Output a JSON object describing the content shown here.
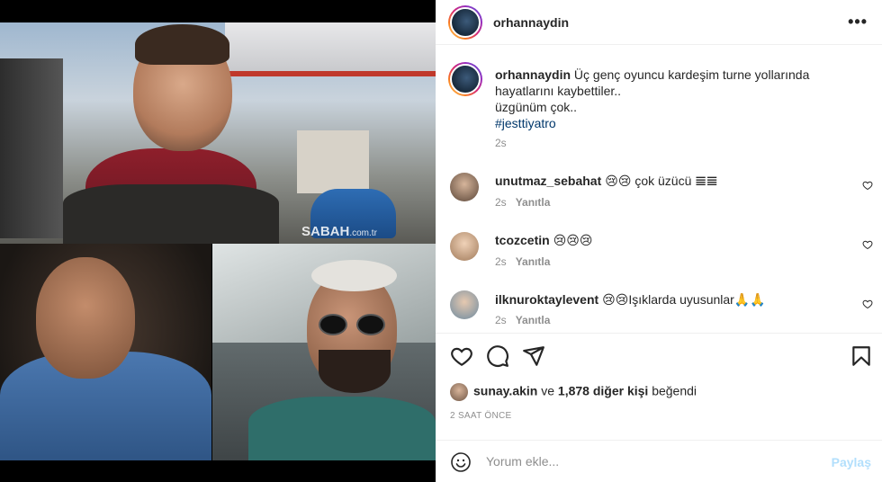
{
  "media": {
    "watermark": "SABAH",
    "watermark_suffix": ".com.tr"
  },
  "header": {
    "username": "orhannaydin",
    "more_icon": "more-horizontal-icon"
  },
  "caption": {
    "username": "orhannaydin",
    "text_line1": "Üç genç oyuncu kardeşim turne yollarında",
    "text_line2": "hayatlarını kaybettiler..",
    "text_line3": "üzgünüm çok..",
    "hashtag": "#jesttiyatro",
    "time": "2s"
  },
  "comments": [
    {
      "username": "unutmaz_sebahat",
      "text": "😢😢 çok üzücü 𝌆𝌆",
      "time": "2s",
      "reply": "Yanıtla"
    },
    {
      "username": "tcozcetin",
      "text": "😢😢😢",
      "time": "2s",
      "reply": "Yanıtla"
    },
    {
      "username": "ilknuroktaylevent",
      "text": "😢😢Işıklarda uyusunlar🙏🙏",
      "time": "2s",
      "reply": "Yanıtla"
    }
  ],
  "actions": {
    "like_icon": "heart-icon",
    "comment_icon": "comment-icon",
    "share_icon": "share-icon",
    "save_icon": "bookmark-icon"
  },
  "likes": {
    "first_user": "sunay.akin",
    "connector": " ve ",
    "others": "1,878 diğer kişi",
    "suffix": " beğendi"
  },
  "timestamp": "2 SAAT ÖNCE",
  "add_comment": {
    "placeholder": "Yorum ekle...",
    "post_label": "Paylaş"
  },
  "colors": {
    "link": "#00376b",
    "muted": "#8e8e8e",
    "post_disabled": "#b2dffc"
  }
}
